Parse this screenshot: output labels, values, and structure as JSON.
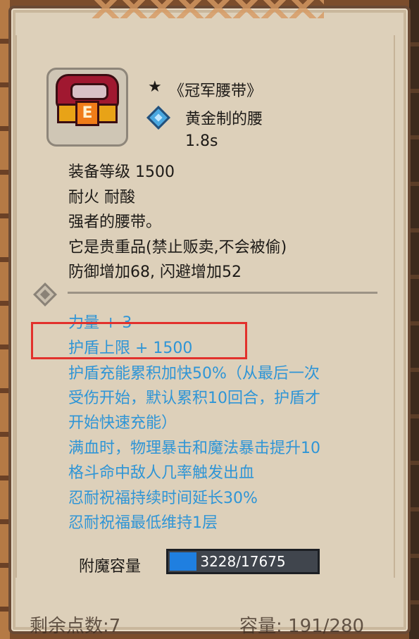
{
  "item": {
    "name": "《冠军腰带》",
    "material": "黄金制的腰",
    "duration": "1.8s",
    "level": "装备等级 1500",
    "resistances": "耐火  耐酸",
    "description": "强者的腰带。",
    "valuable": "它是贵重品(禁止贩卖,不会被偷)",
    "stats": "防御增加68, 闪避增加52"
  },
  "enchantments": [
    "力量 + 3",
    "护盾上限 + 1500",
    "护盾充能累积加快50%（从最后一次",
    "受伤开始，默认累积10回合，护盾才",
    "开始快速充能）",
    "满血时，物理暴击和魔法暴击提升10",
    "格斗命中敌人几率触发出血",
    "忍耐祝福持续时间延长30%",
    "忍耐祝福最低维持1层"
  ],
  "capacity": {
    "label": "附魔容量",
    "value": "3228/17675",
    "fraction": 0.1826
  },
  "footer": {
    "remaining_points": "剩余点数:7",
    "capacity": "容量:  191/280"
  },
  "icons": {
    "star": "★",
    "item": "belt-icon",
    "rarity": "diamond-icon",
    "separator": "diamond-separator-icon"
  }
}
